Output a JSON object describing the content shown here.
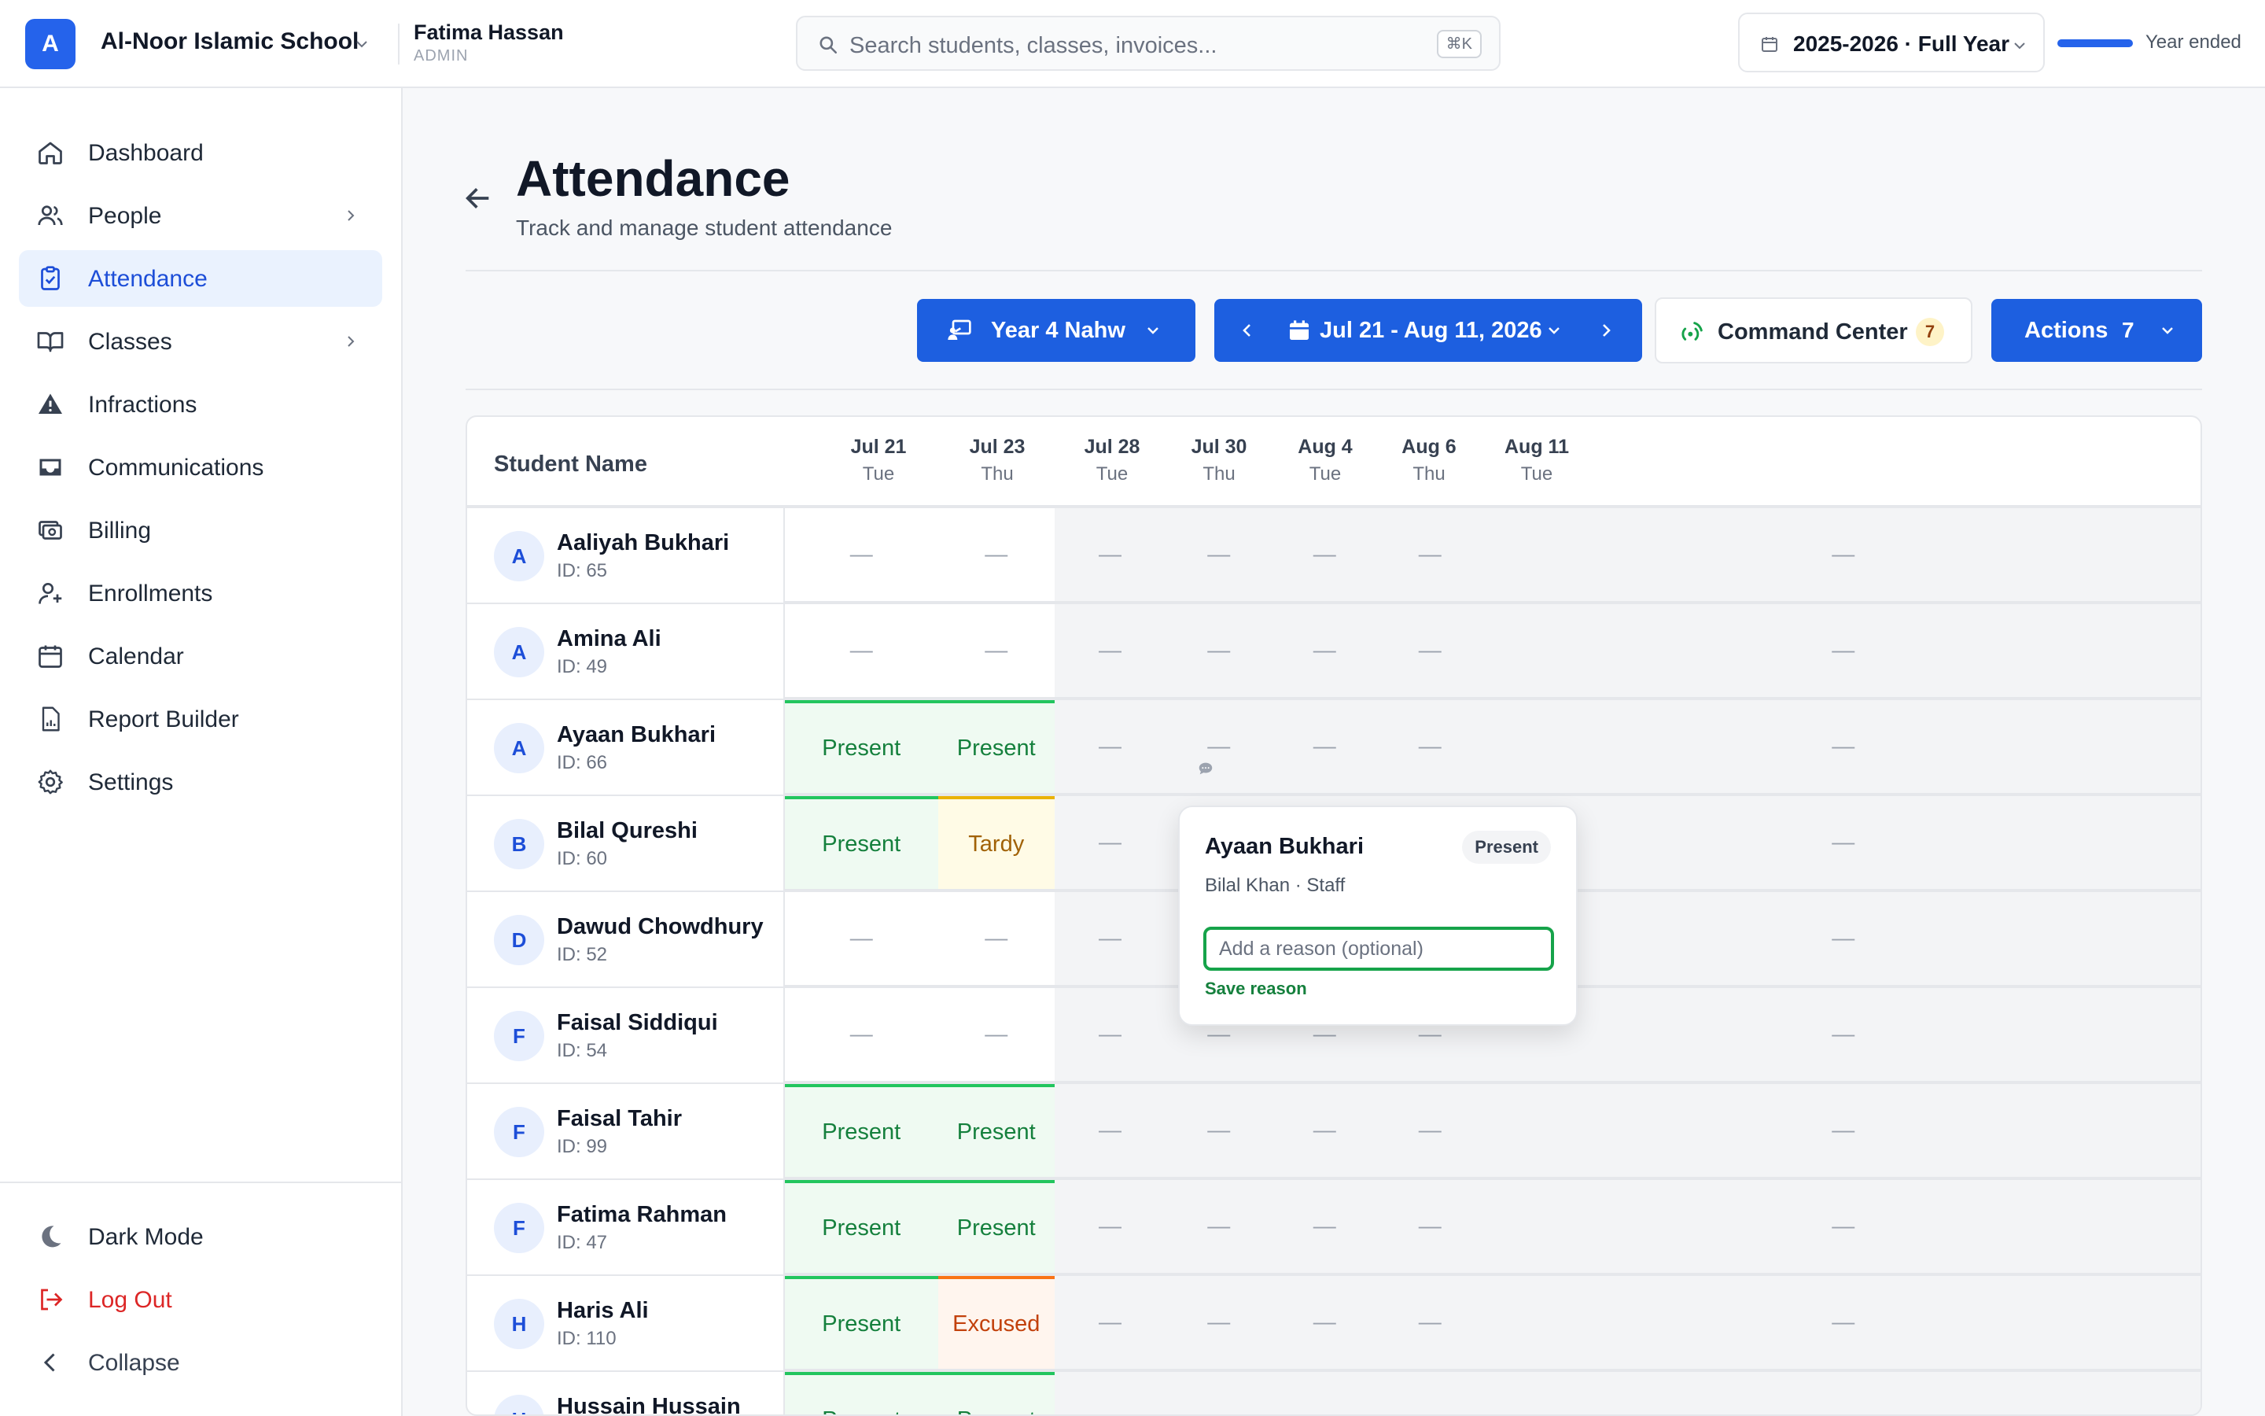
{
  "topbar": {
    "logo_letter": "A",
    "school_name": "Al-Noor Islamic School",
    "user_name": "Fatima Hassan",
    "user_role": "ADMIN",
    "search_placeholder": "Search students, classes, invoices...",
    "search_shortcut": "⌘K",
    "year_label": "2025-2026 · Full Year",
    "year_status": "Year ended",
    "year_progress": 1.0
  },
  "sidebar": {
    "items": [
      {
        "label": "Dashboard",
        "icon": "home-icon",
        "active": false,
        "has_submenu": false
      },
      {
        "label": "People",
        "icon": "people-icon",
        "active": false,
        "has_submenu": true
      },
      {
        "label": "Attendance",
        "icon": "clipboard-check-icon",
        "active": true,
        "has_submenu": false
      },
      {
        "label": "Classes",
        "icon": "book-icon",
        "active": false,
        "has_submenu": true
      },
      {
        "label": "Infractions",
        "icon": "warning-icon",
        "active": false,
        "has_submenu": false
      },
      {
        "label": "Communications",
        "icon": "inbox-icon",
        "active": false,
        "has_submenu": false
      },
      {
        "label": "Billing",
        "icon": "billing-icon",
        "active": false,
        "has_submenu": false
      },
      {
        "label": "Enrollments",
        "icon": "user-plus-icon",
        "active": false,
        "has_submenu": false
      },
      {
        "label": "Calendar",
        "icon": "calendar-icon",
        "active": false,
        "has_submenu": false
      },
      {
        "label": "Report Builder",
        "icon": "report-icon",
        "active": false,
        "has_submenu": false
      },
      {
        "label": "Settings",
        "icon": "gear-icon",
        "active": false,
        "has_submenu": false
      }
    ],
    "dark_mode": "Dark Mode",
    "logout": "Log Out",
    "collapse": "Collapse"
  },
  "page": {
    "title": "Attendance",
    "subtitle": "Track and manage student attendance"
  },
  "toolbar": {
    "class_label": "Year 4 Nahw",
    "date_range": "Jul 21 - Aug 11, 2026",
    "command_center": "Command Center",
    "command_center_count": "7",
    "actions_label": "Actions",
    "actions_count": "7"
  },
  "table": {
    "student_header": "Student Name",
    "days": [
      {
        "date": "Jul 21",
        "weekday": "Tue"
      },
      {
        "date": "Jul 23",
        "weekday": "Thu"
      },
      {
        "date": "Jul 28",
        "weekday": "Tue"
      },
      {
        "date": "Jul 30",
        "weekday": "Thu"
      },
      {
        "date": "Aug 4",
        "weekday": "Tue"
      },
      {
        "date": "Aug 6",
        "weekday": "Thu"
      },
      {
        "date": "Aug 11",
        "weekday": "Tue"
      }
    ],
    "empty_mark": "—",
    "students": [
      {
        "initial": "A",
        "name": "Aaliyah Bukhari",
        "id": "ID: 65",
        "marks": [
          "",
          "",
          "",
          "",
          "",
          "",
          ""
        ]
      },
      {
        "initial": "A",
        "name": "Amina Ali",
        "id": "ID: 49",
        "marks": [
          "",
          "",
          "",
          "",
          "",
          "",
          ""
        ]
      },
      {
        "initial": "A",
        "name": "Ayaan Bukhari",
        "id": "ID: 66",
        "marks": [
          "Present",
          "Present",
          "",
          "",
          "",
          "",
          ""
        ]
      },
      {
        "initial": "B",
        "name": "Bilal Qureshi",
        "id": "ID: 60",
        "marks": [
          "Present",
          "Tardy",
          "",
          "",
          "",
          "",
          ""
        ]
      },
      {
        "initial": "D",
        "name": "Dawud Chowdhury",
        "id": "ID: 52",
        "marks": [
          "",
          "",
          "",
          "",
          "",
          "",
          ""
        ]
      },
      {
        "initial": "F",
        "name": "Faisal Siddiqui",
        "id": "ID: 54",
        "marks": [
          "",
          "",
          "",
          "",
          "",
          "",
          ""
        ]
      },
      {
        "initial": "F",
        "name": "Faisal Tahir",
        "id": "ID: 99",
        "marks": [
          "Present",
          "Present",
          "",
          "",
          "",
          "",
          ""
        ]
      },
      {
        "initial": "F",
        "name": "Fatima Rahman",
        "id": "ID: 47",
        "marks": [
          "Present",
          "Present",
          "",
          "",
          "",
          "",
          ""
        ]
      },
      {
        "initial": "H",
        "name": "Haris Ali",
        "id": "ID: 110",
        "marks": [
          "Present",
          "Excused",
          "",
          "",
          "",
          "",
          ""
        ]
      },
      {
        "initial": "H",
        "name": "Hussain Hussain",
        "id": "",
        "marks": [
          "Present",
          "Present",
          "",
          "",
          "",
          "",
          ""
        ]
      }
    ]
  },
  "popover": {
    "student": "Ayaan Bukhari",
    "status": "Present",
    "recorded_by": "Bilal Khan · Staff",
    "reason_placeholder": "Add a reason (optional)",
    "save_label": "Save reason"
  },
  "colors": {
    "accent": "#1d5fe0",
    "present": "#15803d",
    "tardy": "#a16207",
    "excused": "#c2410c",
    "logout": "#dc2626"
  }
}
